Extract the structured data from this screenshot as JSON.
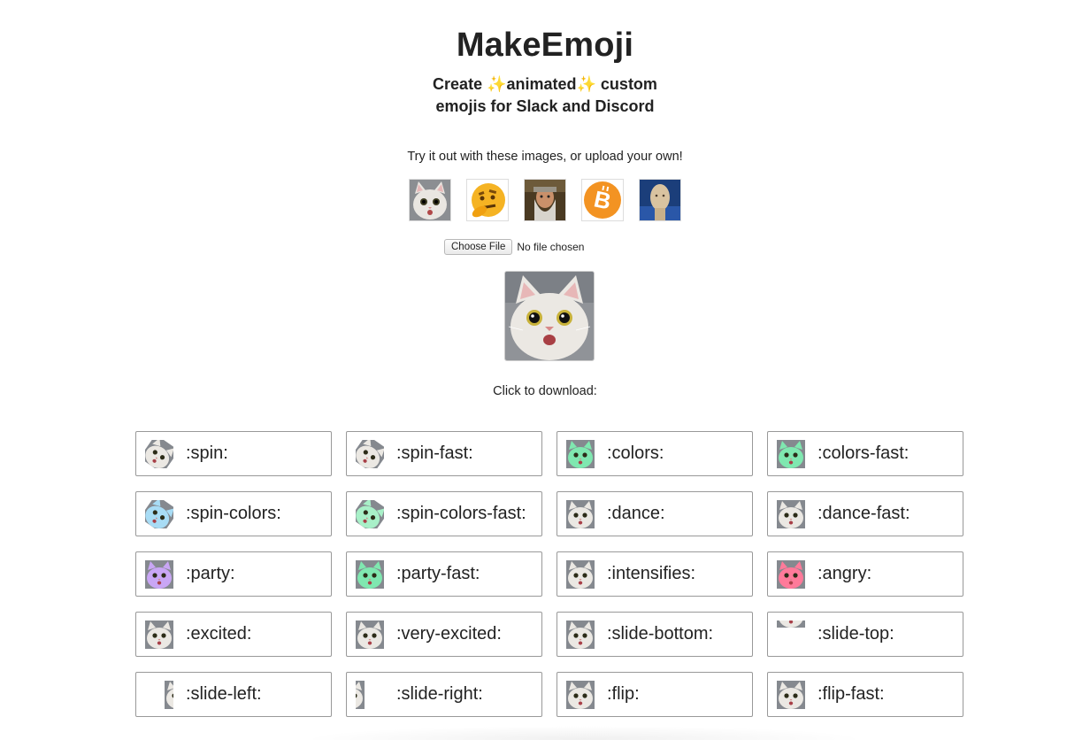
{
  "header": {
    "title": "MakeEmoji",
    "subtitle_line1": "Create ✨animated✨ custom",
    "subtitle_line2": "emojis for Slack and Discord"
  },
  "samples": {
    "prompt": "Try it out with these images, or upload your own!",
    "items": [
      {
        "icon": "cat-face-icon"
      },
      {
        "icon": "thinking-face-icon"
      },
      {
        "icon": "wizard-portrait-icon"
      },
      {
        "icon": "bitcoin-icon"
      },
      {
        "icon": "stonks-head-icon"
      }
    ]
  },
  "upload": {
    "button_label": "Choose File",
    "status": "No file chosen"
  },
  "download": {
    "label": "Click to download:",
    "items": [
      {
        "label": ":spin:",
        "variant": "spin",
        "tint": "#ffffff"
      },
      {
        "label": ":spin-fast:",
        "variant": "spin",
        "tint": "#ffffff"
      },
      {
        "label": ":colors:",
        "variant": "normal",
        "tint": "#7fe8b0"
      },
      {
        "label": ":colors-fast:",
        "variant": "normal",
        "tint": "#7fe8b0"
      },
      {
        "label": ":spin-colors:",
        "variant": "spin",
        "tint": "#a8dcf5"
      },
      {
        "label": ":spin-colors-fast:",
        "variant": "spin",
        "tint": "#a8f0c8"
      },
      {
        "label": ":dance:",
        "variant": "normal",
        "tint": "#ffffff"
      },
      {
        "label": ":dance-fast:",
        "variant": "normal",
        "tint": "#ffffff"
      },
      {
        "label": ":party:",
        "variant": "normal",
        "tint": "#c9a6f5"
      },
      {
        "label": ":party-fast:",
        "variant": "normal",
        "tint": "#7fe8b0"
      },
      {
        "label": ":intensifies:",
        "variant": "normal",
        "tint": "#ffffff"
      },
      {
        "label": ":angry:",
        "variant": "normal",
        "tint": "#ff7a9a"
      },
      {
        "label": ":excited:",
        "variant": "normal",
        "tint": "#ffffff"
      },
      {
        "label": ":very-excited:",
        "variant": "normal",
        "tint": "#ffffff"
      },
      {
        "label": ":slide-bottom:",
        "variant": "normal",
        "tint": "#ffffff"
      },
      {
        "label": ":slide-top:",
        "variant": "slide-top",
        "tint": "#ffffff"
      },
      {
        "label": ":slide-left:",
        "variant": "slide-left",
        "tint": "#ffffff"
      },
      {
        "label": ":slide-right:",
        "variant": "slide-right",
        "tint": "#ffffff"
      },
      {
        "label": ":flip:",
        "variant": "normal",
        "tint": "#ffffff"
      },
      {
        "label": ":flip-fast:",
        "variant": "normal",
        "tint": "#ffffff"
      }
    ]
  }
}
